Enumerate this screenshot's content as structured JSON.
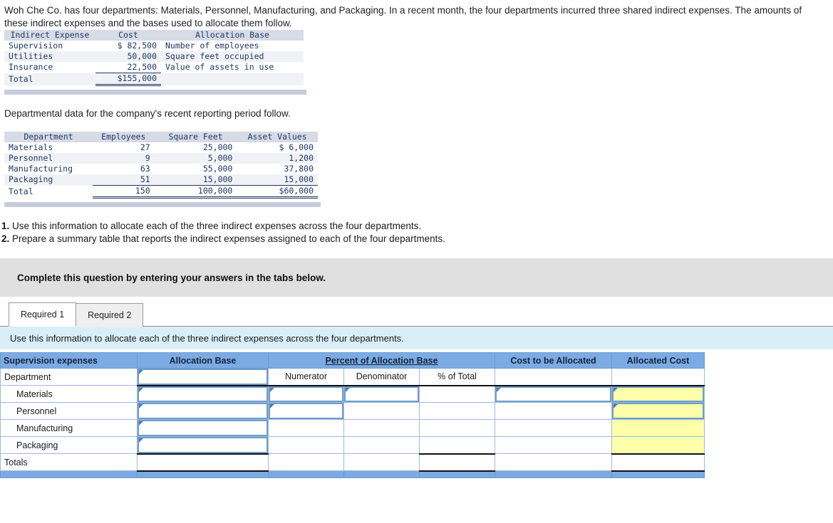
{
  "intro": {
    "paragraph": "Woh Che Co. has four departments: Materials, Personnel, Manufacturing, and Packaging. In a recent month, the four departments incurred three shared indirect expenses. The amounts of these indirect expenses and the bases used to allocate them follow.",
    "sub_note": "Departmental data for the company's recent reporting period follow."
  },
  "expense_table": {
    "headers": [
      "Indirect Expense",
      "Cost",
      "Allocation Base"
    ],
    "rows": [
      {
        "name": "Supervision",
        "cost": "$ 82,500",
        "base": "Number of employees"
      },
      {
        "name": "Utilities",
        "cost": "50,000",
        "base": "Square feet occupied"
      },
      {
        "name": "Insurance",
        "cost": "22,500",
        "base": "Value of assets in use"
      }
    ],
    "total_label": "Total",
    "total_cost": "$155,000"
  },
  "dept_table": {
    "headers": [
      "Department",
      "Employees",
      "Square Feet",
      "Asset Values"
    ],
    "rows": [
      {
        "name": "Materials",
        "employees": "27",
        "sqft": "25,000",
        "assets": "$ 6,000"
      },
      {
        "name": "Personnel",
        "employees": "9",
        "sqft": "5,000",
        "assets": "1,200"
      },
      {
        "name": "Manufacturing",
        "employees": "63",
        "sqft": "55,000",
        "assets": "37,800"
      },
      {
        "name": "Packaging",
        "employees": "51",
        "sqft": "15,000",
        "assets": "15,000"
      }
    ],
    "total_label": "Total",
    "total_employees": "150",
    "total_sqft": "100,000",
    "total_assets": "$60,000"
  },
  "requirements": [
    {
      "num": "1.",
      "text": "Use this information to allocate each of the three indirect expenses across the four departments."
    },
    {
      "num": "2.",
      "text": "Prepare a summary table that reports the indirect expenses assigned to each of the four departments."
    }
  ],
  "complete_band": {
    "text": "Complete this question by entering your answers in the tabs below."
  },
  "tabs": [
    {
      "label": "Required 1",
      "active": true
    },
    {
      "label": "Required 2",
      "active": false
    }
  ],
  "blue_band": {
    "text": "Use this information to allocate each of the three indirect expenses across the four departments."
  },
  "answer_grid": {
    "headers": {
      "col1": "Supervision expenses",
      "col2": "Allocation Base",
      "col3": "Percent of Allocation Base",
      "col4": "Cost to be Allocated",
      "col5": "Allocated Cost"
    },
    "subheaders": {
      "department": "Department",
      "numerator": "Numerator",
      "denominator": "Denominator",
      "percent_of_total": "% of Total"
    },
    "rows": [
      {
        "label": "Materials",
        "allocation_base": "",
        "numerator": "",
        "denominator": "",
        "percent": "",
        "cost_to_allocate": "",
        "allocated_cost": ""
      },
      {
        "label": "Personnel",
        "allocation_base": "",
        "numerator": "",
        "denominator": "",
        "percent": "",
        "cost_to_allocate": "",
        "allocated_cost": ""
      },
      {
        "label": "Manufacturing",
        "allocation_base": "",
        "numerator": "",
        "denominator": "",
        "percent": "",
        "cost_to_allocate": "",
        "allocated_cost": ""
      },
      {
        "label": "Packaging",
        "allocation_base": "",
        "numerator": "",
        "denominator": "",
        "percent": "",
        "cost_to_allocate": "",
        "allocated_cost": ""
      }
    ],
    "totals_label": "Totals"
  },
  "colors": {
    "header_blue": "#7cabe3",
    "band_blue": "#daeef8",
    "input_border": "#6d9ecb",
    "highlight_yellow": "#ffffaa",
    "complete_gray": "#e0e0e0",
    "mono_text": "#1f3864",
    "table_header_gray": "#d7dbe6",
    "table_stripe": "#f1f2f5",
    "table_footer_bar": "#c6ccdd"
  }
}
